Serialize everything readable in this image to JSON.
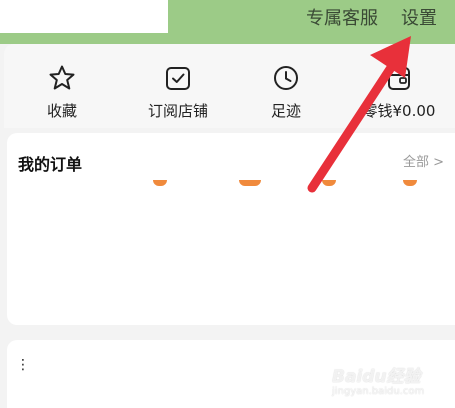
{
  "header": {
    "service_label": "专属客服",
    "settings_label": "设置"
  },
  "quick_actions": [
    {
      "label": "收藏",
      "icon": "star-icon"
    },
    {
      "label": "订阅店铺",
      "icon": "subscribe-icon"
    },
    {
      "label": "足迹",
      "icon": "clock-icon"
    },
    {
      "label": "零钱¥0.00",
      "icon": "wallet-icon"
    }
  ],
  "orders": {
    "title": "我的订单",
    "all_label": "全部 >"
  },
  "bottom_card": {
    "more_icon": "more-vertical-icon"
  },
  "watermark": {
    "brand": "Baidu经验",
    "url": "jingyan.baidu.com"
  },
  "annotation": {
    "arrow_color": "#e8303a"
  },
  "colors": {
    "header_bg": "#9ccb87",
    "accent_orange": "#f08a3c"
  }
}
